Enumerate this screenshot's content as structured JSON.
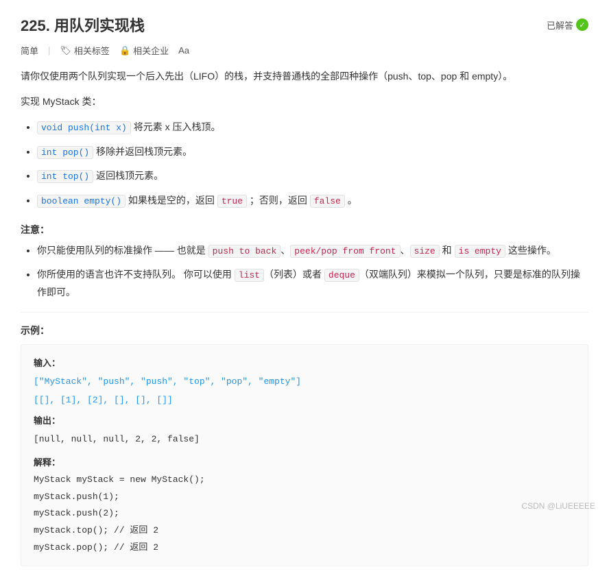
{
  "header": {
    "problem_number": "225.",
    "title": "用队列实现栈",
    "solved_label": "已解答",
    "check_mark": "✓"
  },
  "tags": {
    "difficulty": "简单",
    "related_tags_label": "相关标签",
    "related_companies_label": "相关企业",
    "font_icon": "Aa"
  },
  "description": {
    "line1": "请你仅使用两个队列实现一个后入先出（LIFO）的栈，并支持普通栈的全部四种操作（push、top、pop 和 empty）。",
    "line2": "实现 MyStack 类："
  },
  "methods": [
    {
      "signature": "void push(int x)",
      "desc": "将元素 x 压入栈顶。"
    },
    {
      "signature": "int pop()",
      "desc": "移除并返回栈顶元素。"
    },
    {
      "signature": "int top()",
      "desc": "返回栈顶元素。"
    },
    {
      "signature": "boolean empty()",
      "desc": "如果栈是空的，返回 true ；否则，返回 false 。"
    }
  ],
  "note": {
    "title": "注意：",
    "items": [
      "你只能使用队列的标准操作 —— 也就是 push to back、peek/pop from front、size 和 is empty 这些操作。",
      "你所使用的语言也许不支持队列。 你可以使用 list（列表）或者 deque（双端队列）来模拟一个队列，只要是标准的队列操作即可。"
    ]
  },
  "example": {
    "title": "示例：",
    "input_label": "输入：",
    "input_line1": "[\"MyStack\", \"push\", \"push\", \"top\", \"pop\", \"empty\"]",
    "input_line2": "[[], [1], [2], [], [], []]",
    "output_label": "输出：",
    "output_value": "[null, null, null, 2, 2, false]",
    "explain_label": "解释：",
    "code_lines": [
      "MyStack myStack = new MyStack();",
      "myStack.push(1);",
      "myStack.push(2);",
      "myStack.top();   // 返回 2",
      "myStack.pop();   // 返回 2"
    ]
  },
  "footer": {
    "brand": "CSDN @LiUEEEEE"
  }
}
